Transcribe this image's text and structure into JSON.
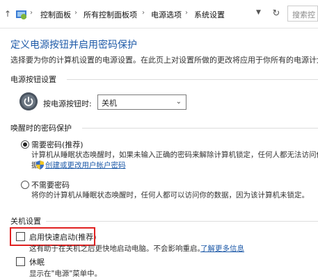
{
  "address_bar": {
    "breadcrumbs": [
      "控制面板",
      "所有控制面板项",
      "电源选项",
      "系统设置"
    ],
    "search_placeholder": "搜索控"
  },
  "page": {
    "title": "定义电源按钮并启用密码保护",
    "description": "选择要为你的计算机设置的电源设置。在此页上对设置所做的更改将应用于你所有的电源计划。"
  },
  "power_button": {
    "section_title": "电源按钮设置",
    "label": "按电源按钮时:",
    "selected": "关机"
  },
  "wakeup": {
    "section_title": "唤醒时的密码保护",
    "options": [
      {
        "label": "需要密码(推荐)",
        "desc_line1": "计算机从睡眠状态唤醒时，如果未输入正确的密码来解除计算机锁定，任何人都无法访问你",
        "desc_line2": "据。",
        "link": "创建或更改用户帐户密码",
        "selected": true
      },
      {
        "label": "不需要密码",
        "desc_line1": "将你的计算机从睡眠状态唤醒时，任何人都可以访问你的数据，因为该计算机未锁定。",
        "selected": false
      }
    ]
  },
  "shutdown": {
    "section_title": "关机设置",
    "options": [
      {
        "label": "启用快速启动(推荐)",
        "desc": "这有助于在关机之后更快地启动电脑。不会影响重启。",
        "link": "了解更多信息",
        "checked": false
      },
      {
        "label": "休眠",
        "desc": "显示在\"电源\"菜单中。",
        "checked": false
      }
    ]
  },
  "highlight_color": "#e02020",
  "accent_color": "#1e5aa8"
}
